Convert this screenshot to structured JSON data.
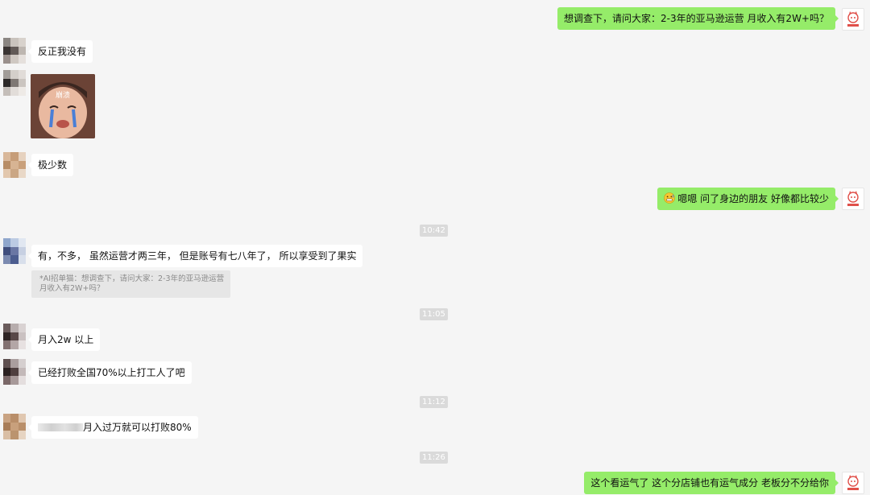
{
  "messages": {
    "m1": "想调查下，请问大家：2-3年的亚马逊运营 月收入有2W+吗？",
    "m2": "反正我没有",
    "m3_sticker_caption": "崩溃",
    "m4": "极少数",
    "m5": "嗯嗯 问了身边的朋友 好像都比较少",
    "m6": "有，不多， 虽然运营才两三年， 但是账号有七八年了， 所以享受到了果实",
    "m6_quote_line1": "*AI招单猫：想调查下，请问大家：2-3年的亚马逊运营",
    "m6_quote_line2": "月收入有2W+吗？",
    "m7": "月入2w 以上",
    "m8": "已经打败全国70%以上打工人了吧",
    "m9": "月入过万就可以打败80%",
    "m10": "这个看运气了 这个分店铺也有运气成分 老板分不分给你"
  },
  "times": {
    "t1": "10:42",
    "t2": "11:05",
    "t3": "11:12",
    "t4": "11:26"
  },
  "icons": {
    "my_avatar": "cat-logo-icon",
    "emoji": "grimace-emoji-icon",
    "sticker": "crying-child-sticker"
  },
  "colors": {
    "background": "#f5f5f5",
    "incoming_bubble": "#ffffff",
    "outgoing_bubble": "#95ec69",
    "time_badge": "#dadada",
    "quote_bg": "#e6e6e6"
  }
}
